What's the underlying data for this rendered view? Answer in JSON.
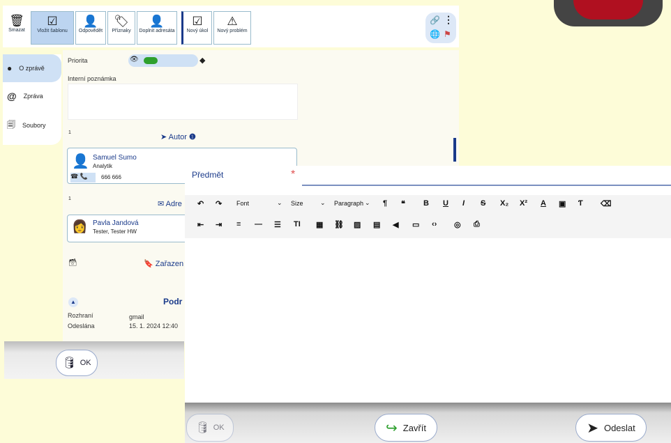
{
  "toolbar": {
    "delete": "Smazat",
    "template": "Vložit šablonu",
    "reply": "Odpovědět",
    "flags": "Příznaky",
    "addressee": "Doplnit adresáta",
    "task": "Nový úkol",
    "problem": "Nový problém"
  },
  "sidebar": {
    "items": [
      {
        "label": "O zprávě"
      },
      {
        "label": "Zpráva"
      },
      {
        "label": "Soubory"
      }
    ]
  },
  "main": {
    "priority": "Priorita",
    "note": "Interní poznámka",
    "sup1": "1",
    "author_title": "Autor",
    "author_name": "Samuel Sumo",
    "author_role": "Analytik",
    "author_phone": "666 666",
    "addr_title": "Adre",
    "sup2": "1",
    "recipient_name": "Pavla Jandová",
    "recipient_role": "Tester, Tester HW",
    "category_title": "Zařazen",
    "details_title": "Podr",
    "iface_label": "Rozhraní",
    "iface_value": "gmail",
    "sent_label": "Odeslána",
    "sent_value": "15. 1. 2024 12:40"
  },
  "back_ok": "OK",
  "editor": {
    "subject_label": "Předmět",
    "required_star": "*",
    "font": "Font",
    "size": "Size",
    "paragraph": "Paragraph",
    "ok": "OK",
    "close": "Zavřít",
    "send": "Odeslat"
  },
  "colors": {
    "accent": "#1a3a8a",
    "toggle": "#2ea02e",
    "star": "#e05050"
  }
}
